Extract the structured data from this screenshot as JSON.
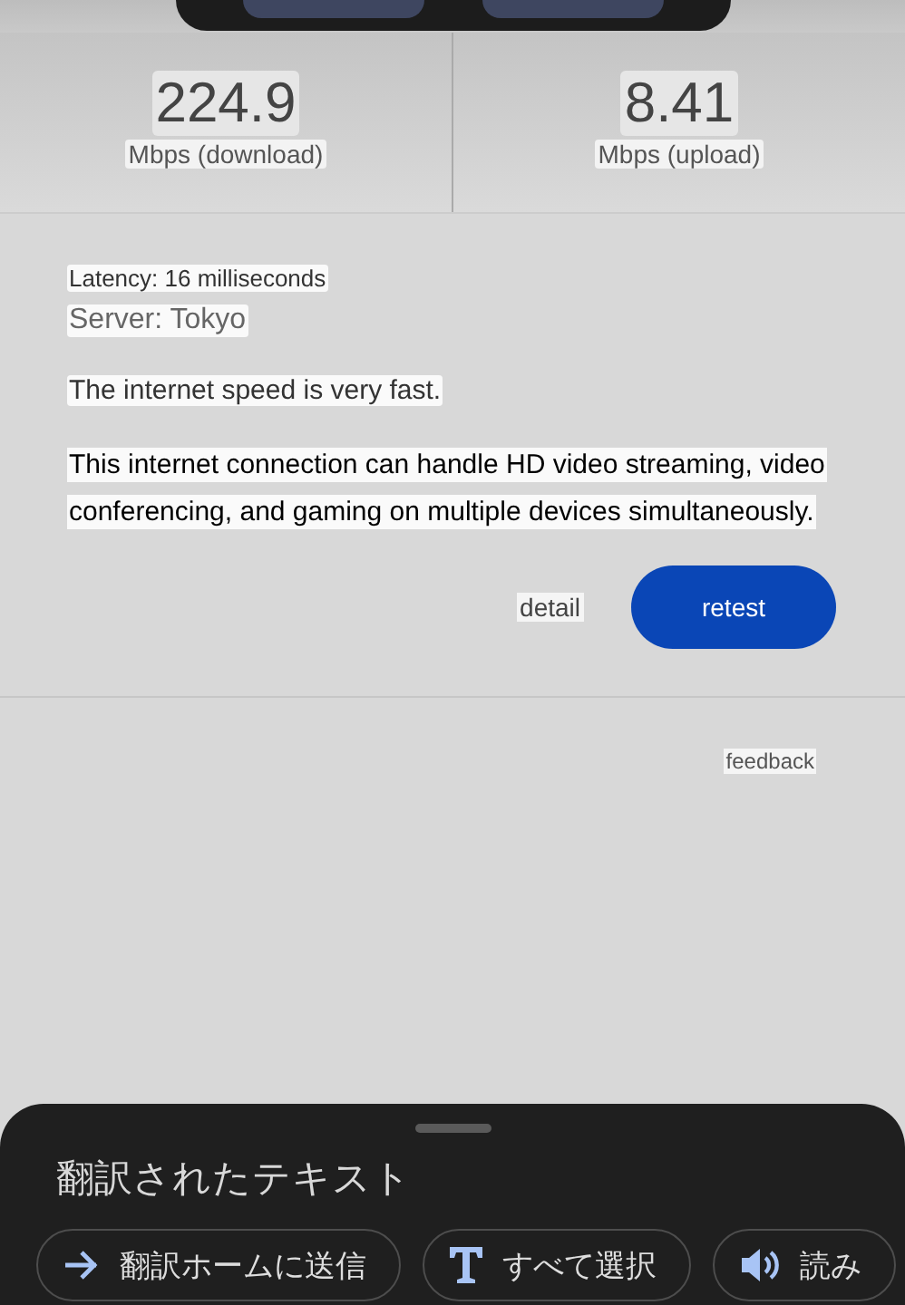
{
  "results": [
    {
      "value": "224.9",
      "unit": "Mbps (download)"
    },
    {
      "value": "8.41",
      "unit": "Mbps (upload)"
    }
  ],
  "details": {
    "latency": "Latency: 16 milliseconds",
    "server": "Server: Tokyo",
    "verdict": "The internet speed is very fast.",
    "description": "This internet connection can handle HD video streaming, video conferencing, and gaming on multiple devices simultaneously."
  },
  "actions": {
    "detail": "detail",
    "retest": "retest"
  },
  "feedback": "feedback",
  "sheet": {
    "title": "翻訳されたテキスト",
    "chips": [
      {
        "kind": "send",
        "label": "翻訳ホームに送信"
      },
      {
        "kind": "select",
        "label": "すべて選択"
      },
      {
        "kind": "speak",
        "label": "読み"
      }
    ]
  }
}
